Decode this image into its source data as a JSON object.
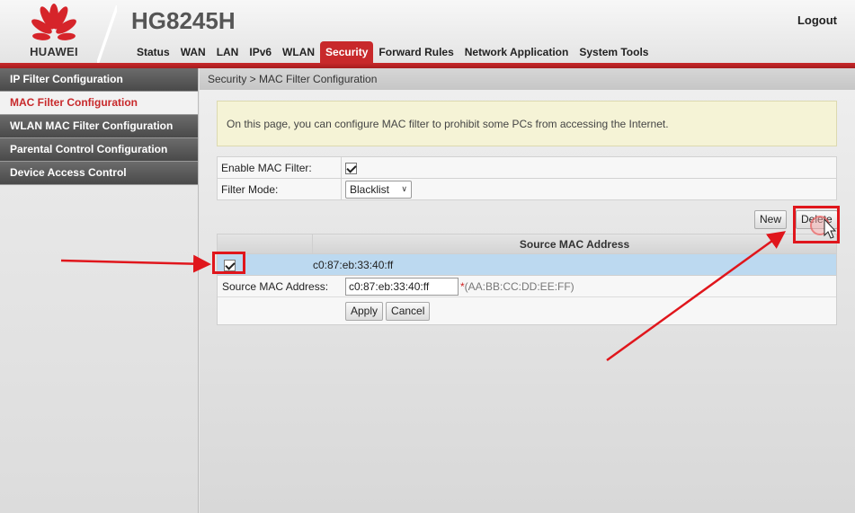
{
  "header": {
    "brand": "HUAWEI",
    "model": "HG8245H",
    "logout": "Logout",
    "menu": [
      "Status",
      "WAN",
      "LAN",
      "IPv6",
      "WLAN",
      "Security",
      "Forward Rules",
      "Network Application",
      "System Tools"
    ],
    "active_menu": "Security"
  },
  "sidebar": {
    "items": [
      {
        "label": "IP Filter Configuration",
        "active": false
      },
      {
        "label": "MAC Filter Configuration",
        "active": true
      },
      {
        "label": "WLAN MAC Filter Configuration",
        "active": false
      },
      {
        "label": "Parental Control Configuration",
        "active": false
      },
      {
        "label": "Device Access Control",
        "active": false
      }
    ]
  },
  "main": {
    "breadcrumb": "Security > MAC Filter Configuration",
    "info": "On this page, you can configure MAC filter to prohibit some PCs from accessing the Internet.",
    "enable_label": "Enable MAC Filter:",
    "enable_checked": true,
    "mode_label": "Filter Mode:",
    "mode_value": "Blacklist",
    "new_button": "New",
    "delete_button": "Delete",
    "table_header": "Source MAC Address",
    "rows": [
      {
        "checked": true,
        "mac": "c0:87:eb:33:40:ff"
      }
    ],
    "edit_label": "Source MAC Address:",
    "edit_value": "c0:87:eb:33:40:ff",
    "hint_star": "*",
    "hint_text": "(AA:BB:CC:DD:EE:FF)",
    "apply_button": "Apply",
    "cancel_button": "Cancel"
  },
  "colors": {
    "accent_red": "#c8292b",
    "annotation_red": "#e0161c",
    "selected_row": "#bcd9f0",
    "info_bg": "#f5f3d6"
  }
}
